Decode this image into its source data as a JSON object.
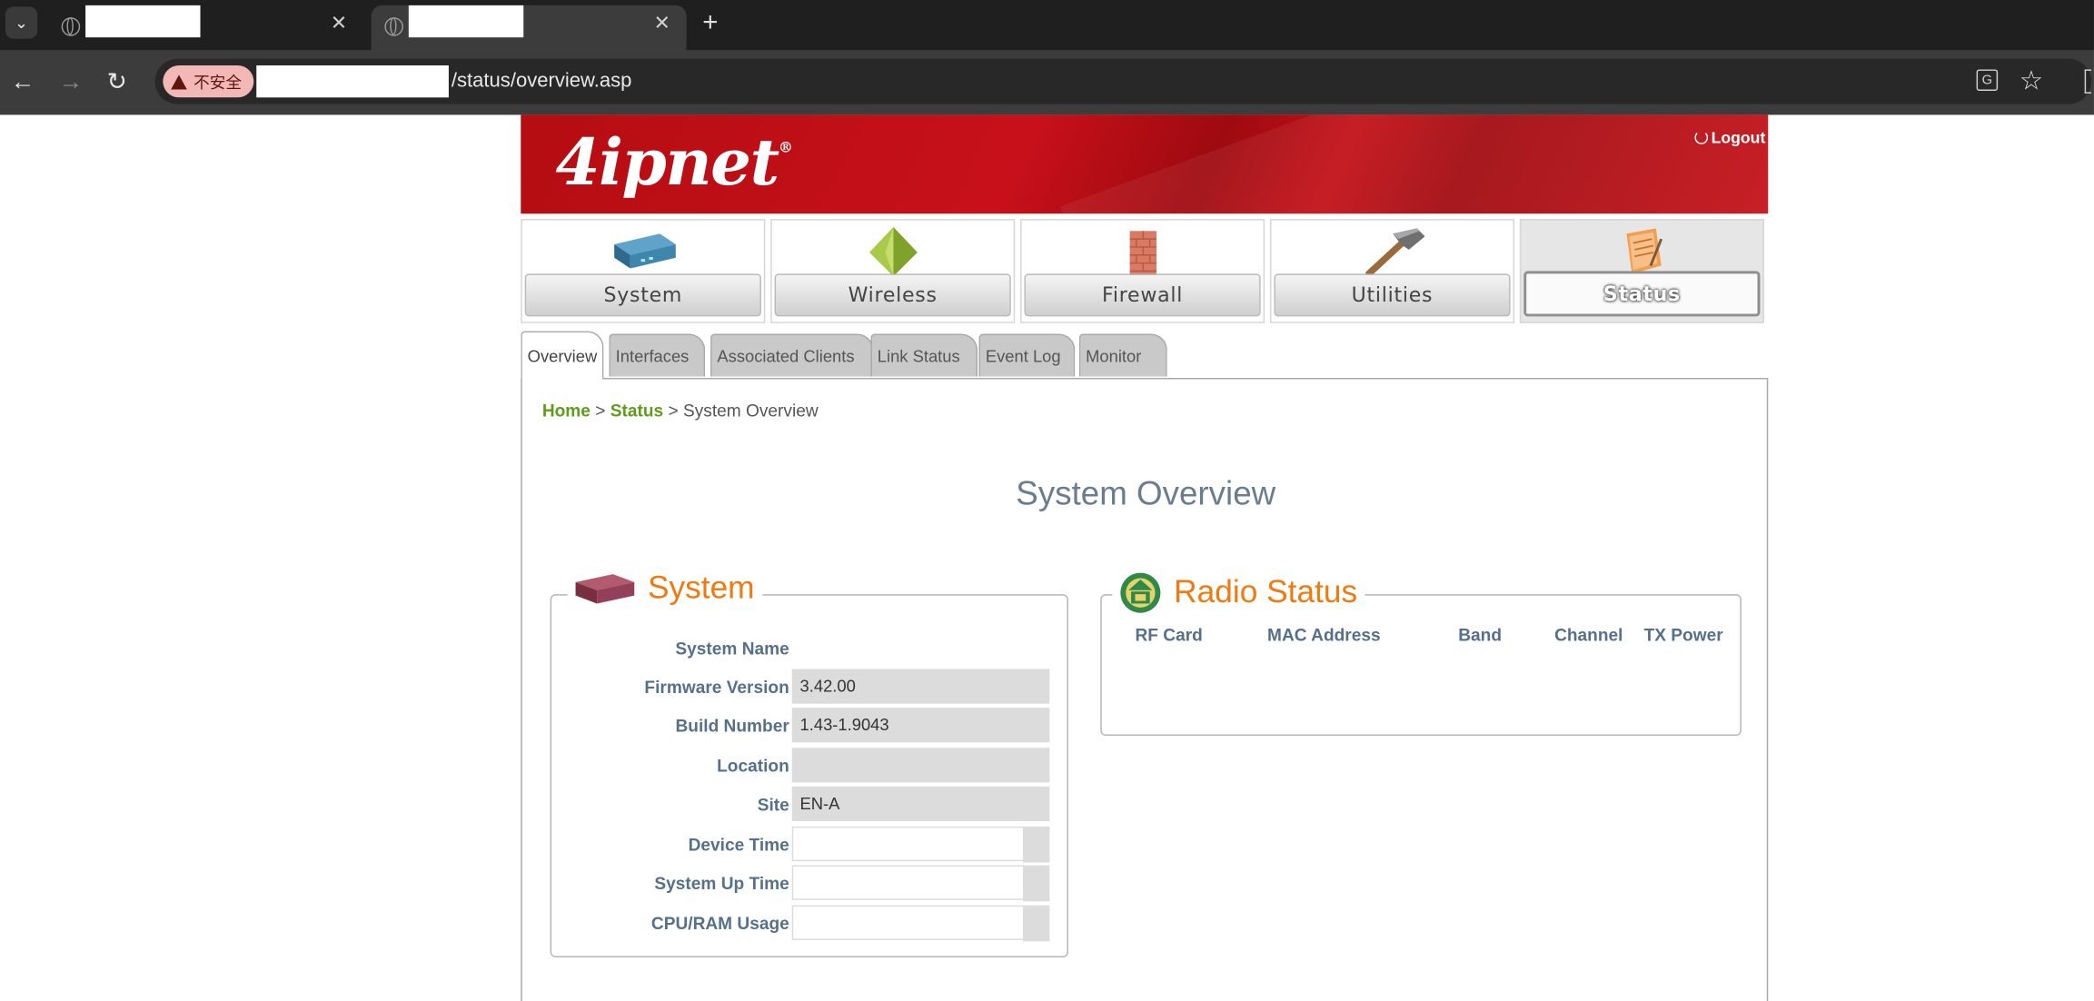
{
  "browser": {
    "tab_close": "✕",
    "new_tab": "+",
    "insecure_label": "不安全",
    "url_path": "/status/overview.asp"
  },
  "header": {
    "logo": "4ipnet",
    "logo_mark": "®",
    "logout": "Logout"
  },
  "menu": [
    {
      "label": "System"
    },
    {
      "label": "Wireless"
    },
    {
      "label": "Firewall"
    },
    {
      "label": "Utilities"
    },
    {
      "label": "Status"
    }
  ],
  "tabs": [
    {
      "label": "Overview"
    },
    {
      "label": "Interfaces"
    },
    {
      "label": "Associated Clients"
    },
    {
      "label": "Link Status"
    },
    {
      "label": "Event Log"
    },
    {
      "label": "Monitor"
    }
  ],
  "breadcrumb": {
    "home": "Home",
    "sep": ">",
    "status": "Status",
    "current": "System Overview"
  },
  "page_title": "System Overview",
  "system": {
    "legend": "System",
    "rows": [
      {
        "label": "System Name",
        "value": ""
      },
      {
        "label": "Firmware Version",
        "value": "3.42.00"
      },
      {
        "label": "Build Number",
        "value": "1.43-1.9043"
      },
      {
        "label": "Location",
        "value": ""
      },
      {
        "label": "Site",
        "value": "EN-A"
      },
      {
        "label": "Device Time",
        "value": ""
      },
      {
        "label": "System Up Time",
        "value": ""
      },
      {
        "label": "CPU/RAM Usage",
        "value": ""
      }
    ]
  },
  "radio": {
    "legend": "Radio Status",
    "columns": [
      "RF Card",
      "MAC Address",
      "Band",
      "Channel",
      "TX Power"
    ]
  }
}
